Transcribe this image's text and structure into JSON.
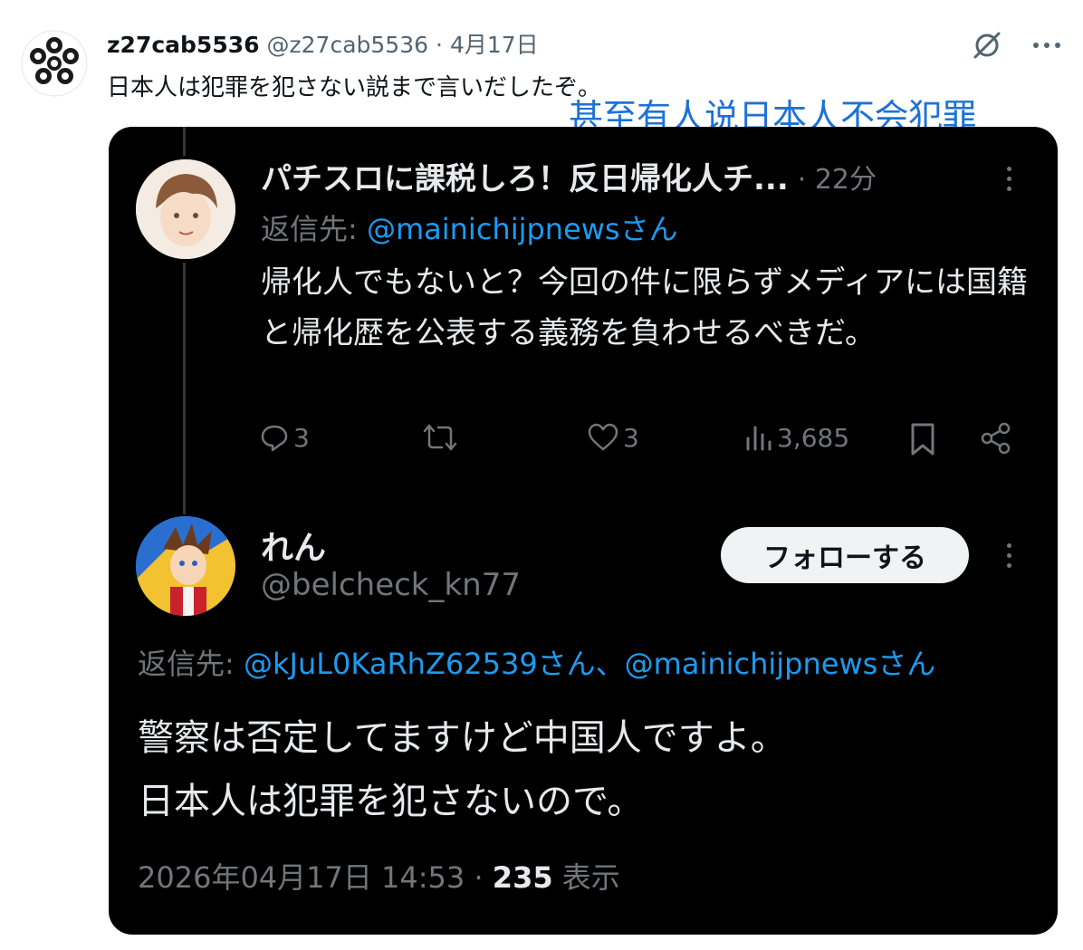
{
  "outer_tweet": {
    "author_name": "z27cab5536",
    "author_handle": "@z27cab5536",
    "separator": "·",
    "date": "4月17日",
    "text": "日本人は犯罪を犯さない説まで言いだしたぞ。",
    "more_icon": "more-horizontal-icon",
    "grok_icon": "grok-icon"
  },
  "caption": "甚至有人说日本人不会犯罪",
  "embedded": {
    "reply1": {
      "author_name": "パチスロに課税しろ！反日帰化人チ...",
      "time": "· 22分",
      "reply_prefix": "返信先: ",
      "reply_to": "@mainichijpnewsさん",
      "body": "帰化人でもないと？今回の件に限らずメディアには国籍と帰化歴を公表する義務を負わせるべきだ。",
      "actions": {
        "replies": "3",
        "retweets": "",
        "likes": "3",
        "views": "3,685"
      }
    },
    "reply2": {
      "author_name": "れん",
      "author_handle": "@belcheck_kn77",
      "follow_label": "フォローする",
      "reply_prefix": "返信先: ",
      "reply_to": "@kJuL0KaRhZ62539さん、@mainichijpnewsさん",
      "body_line1": "警察は否定してますけど中国人ですよ。",
      "body_line2": "日本人は犯罪を犯さないので。",
      "timestamp": "2026年04月17日 14:53 · ",
      "views_count": "235",
      "views_label": " 表示"
    }
  },
  "colors": {
    "link": "#1d9bf0",
    "caption": "#1d72d6",
    "card_bg": "#000000",
    "muted": "#71767b"
  }
}
